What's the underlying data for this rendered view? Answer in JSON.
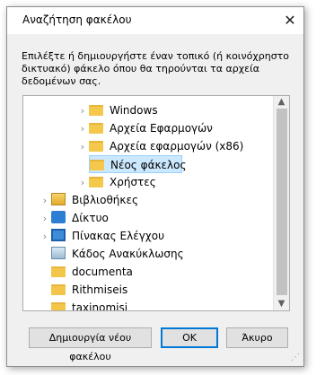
{
  "window": {
    "title": "Αναζήτηση φακέλου",
    "close_icon": "close-icon"
  },
  "instruction": "Επιλέξτε ή δημιουργήστε έναν τοπικό (ή κοινόχρηστο δικτυακό) φάκελο όπου θα τηρούνται τα αρχεία δεδομένων σας.",
  "tree": {
    "items": [
      {
        "label": "Windows",
        "icon": "folder-icon",
        "expanded": false
      },
      {
        "label": "Αρχεία Εφαρμογών",
        "icon": "folder-icon",
        "expanded": false
      },
      {
        "label": "Αρχεία εφαρμογών (x86)",
        "icon": "folder-icon",
        "expanded": false
      },
      {
        "label": "Νέος φάκελος",
        "icon": "folder-icon",
        "selected": true
      },
      {
        "label": "Χρήστες",
        "icon": "folder-icon",
        "expanded": false
      },
      {
        "label": "Βιβλιοθήκες",
        "icon": "libraries-icon",
        "expanded": false
      },
      {
        "label": "Δίκτυο",
        "icon": "network-icon",
        "expanded": false
      },
      {
        "label": "Πίνακας Ελέγχου",
        "icon": "control-panel-icon",
        "expanded": false
      },
      {
        "label": "Κάδος Ανακύκλωσης",
        "icon": "recycle-bin-icon"
      },
      {
        "label": "documenta",
        "icon": "folder-icon"
      },
      {
        "label": "Rithmiseis",
        "icon": "folder-icon"
      },
      {
        "label": "taxinomisi",
        "icon": "folder-icon"
      }
    ]
  },
  "buttons": {
    "new_folder": "Δημιουργία νέου φακέλου",
    "ok": "OK",
    "cancel": "Άκυρο"
  }
}
